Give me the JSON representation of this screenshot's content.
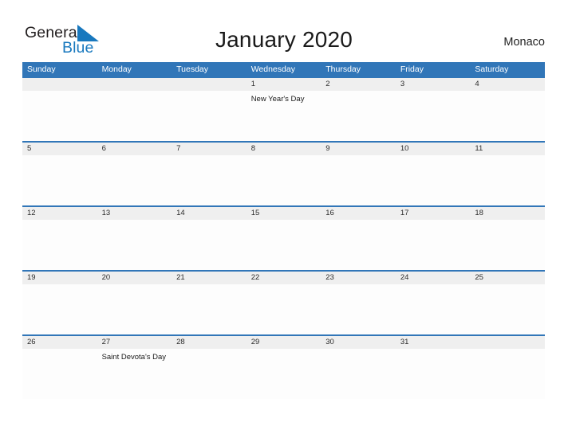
{
  "brand": {
    "name_part1": "General",
    "name_part2": "Blue",
    "flag_icon": "blue-flag-triangle",
    "accent_color": "#1878be"
  },
  "header": {
    "title": "January 2020",
    "location": "Monaco"
  },
  "calendar": {
    "month": "January",
    "year": "2020",
    "header_bg_color": "#3176b8",
    "band_color": "#efefef",
    "weekday_headers": [
      "Sunday",
      "Monday",
      "Tuesday",
      "Wednesday",
      "Thursday",
      "Friday",
      "Saturday"
    ],
    "weeks": [
      [
        {
          "day": "",
          "event": ""
        },
        {
          "day": "",
          "event": ""
        },
        {
          "day": "",
          "event": ""
        },
        {
          "day": "1",
          "event": "New Year's Day"
        },
        {
          "day": "2",
          "event": ""
        },
        {
          "day": "3",
          "event": ""
        },
        {
          "day": "4",
          "event": ""
        }
      ],
      [
        {
          "day": "5",
          "event": ""
        },
        {
          "day": "6",
          "event": ""
        },
        {
          "day": "7",
          "event": ""
        },
        {
          "day": "8",
          "event": ""
        },
        {
          "day": "9",
          "event": ""
        },
        {
          "day": "10",
          "event": ""
        },
        {
          "day": "11",
          "event": ""
        }
      ],
      [
        {
          "day": "12",
          "event": ""
        },
        {
          "day": "13",
          "event": ""
        },
        {
          "day": "14",
          "event": ""
        },
        {
          "day": "15",
          "event": ""
        },
        {
          "day": "16",
          "event": ""
        },
        {
          "day": "17",
          "event": ""
        },
        {
          "day": "18",
          "event": ""
        }
      ],
      [
        {
          "day": "19",
          "event": ""
        },
        {
          "day": "20",
          "event": ""
        },
        {
          "day": "21",
          "event": ""
        },
        {
          "day": "22",
          "event": ""
        },
        {
          "day": "23",
          "event": ""
        },
        {
          "day": "24",
          "event": ""
        },
        {
          "day": "25",
          "event": ""
        }
      ],
      [
        {
          "day": "26",
          "event": ""
        },
        {
          "day": "27",
          "event": "Saint Devota's Day"
        },
        {
          "day": "28",
          "event": ""
        },
        {
          "day": "29",
          "event": ""
        },
        {
          "day": "30",
          "event": ""
        },
        {
          "day": "31",
          "event": ""
        },
        {
          "day": "",
          "event": ""
        }
      ]
    ]
  }
}
